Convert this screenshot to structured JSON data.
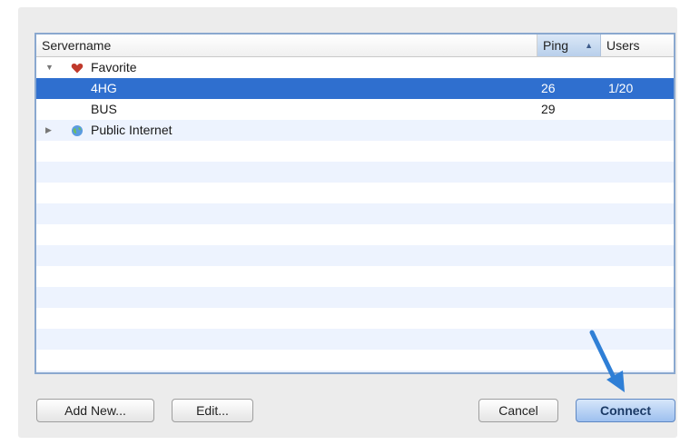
{
  "table": {
    "columns": {
      "servername": "Servername",
      "ping": "Ping",
      "users": "Users"
    },
    "sort_indicator": "▲",
    "groups": [
      {
        "label": "Favorite",
        "expanded": true,
        "icon": "heart-icon",
        "servers": [
          {
            "name": "4HG",
            "ping": "26",
            "users": "1/20",
            "selected": true
          },
          {
            "name": "BUS",
            "ping": "29",
            "users": "",
            "selected": false
          }
        ]
      },
      {
        "label": "Public Internet",
        "expanded": false,
        "icon": "globe-icon",
        "servers": []
      }
    ]
  },
  "buttons": {
    "add_new": "Add New...",
    "edit": "Edit...",
    "cancel": "Cancel",
    "connect": "Connect"
  },
  "colors": {
    "selection": "#2f6fcf",
    "frame": "#8aa8cf",
    "stripe": "#edf3fe",
    "arrow": "#2f7fd6",
    "heart": "#c0392b"
  }
}
